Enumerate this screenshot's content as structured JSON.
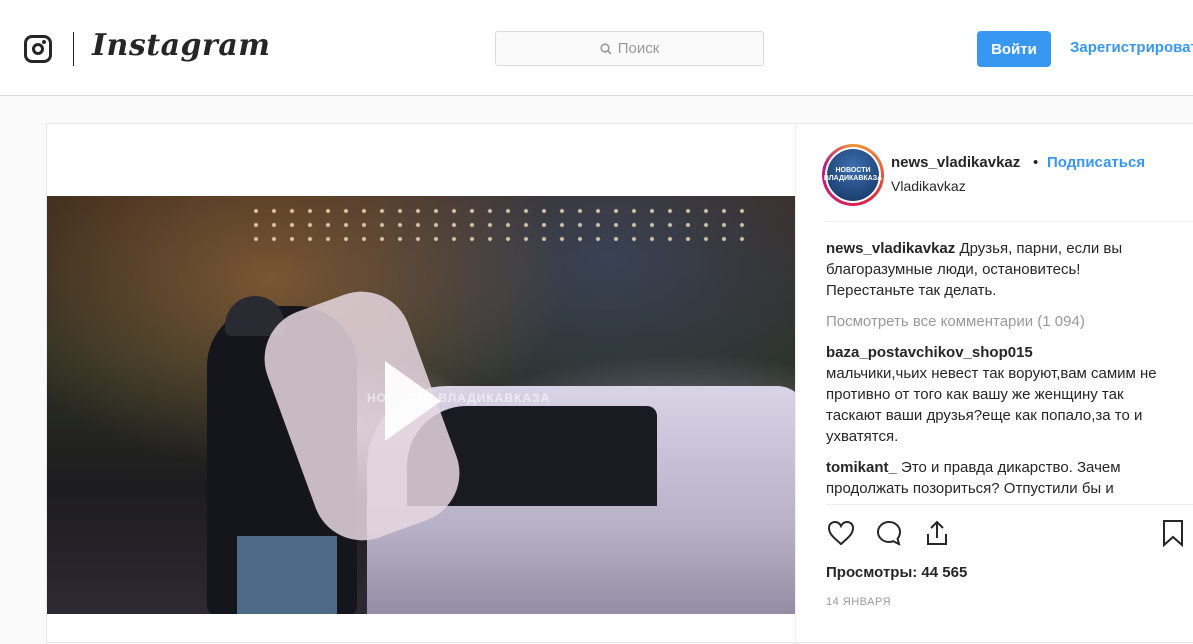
{
  "header": {
    "brand": "Instagram",
    "search_placeholder": "Поиск",
    "login_label": "Войти",
    "register_label": "Зарегистрироваться"
  },
  "media": {
    "watermark": "НОВОСТИ ВЛАДИКАВКАЗА"
  },
  "post": {
    "username": "news_vladikavkaz",
    "separator": "•",
    "follow_label": "Подписаться",
    "location": "Vladikavkaz",
    "avatar_text": "НОВОСТИ ВЛАДИКАВКАЗА",
    "caption_user": "news_vladikavkaz",
    "caption_text": "Друзья, парни, если вы благоразумные люди, остановитесь! Перестаньте так делать.",
    "view_all_comments": "Посмотреть все комментарии (1 094)",
    "comments": [
      {
        "user": "baza_postavchikov_shop015",
        "text": "мальчики,чьих невест так воруют,вам самим не противно от того как вашу же женщину так таскают ваши друзья?еще как попало,за то и ухватятся."
      },
      {
        "user": "tomikant_",
        "text": "Это и правда дикарство. Зачем продолжать позориться? Отпустили бы и"
      }
    ],
    "views": "Просмотры: 44 565",
    "date": "14 ЯНВАРЯ"
  },
  "icons": {
    "like": "heart-icon",
    "comment": "comment-bubble-icon",
    "share": "share-icon",
    "save": "bookmark-icon",
    "search": "search-icon"
  },
  "colors": {
    "accent": "#3897f0",
    "text": "#262626",
    "muted": "#999999"
  }
}
